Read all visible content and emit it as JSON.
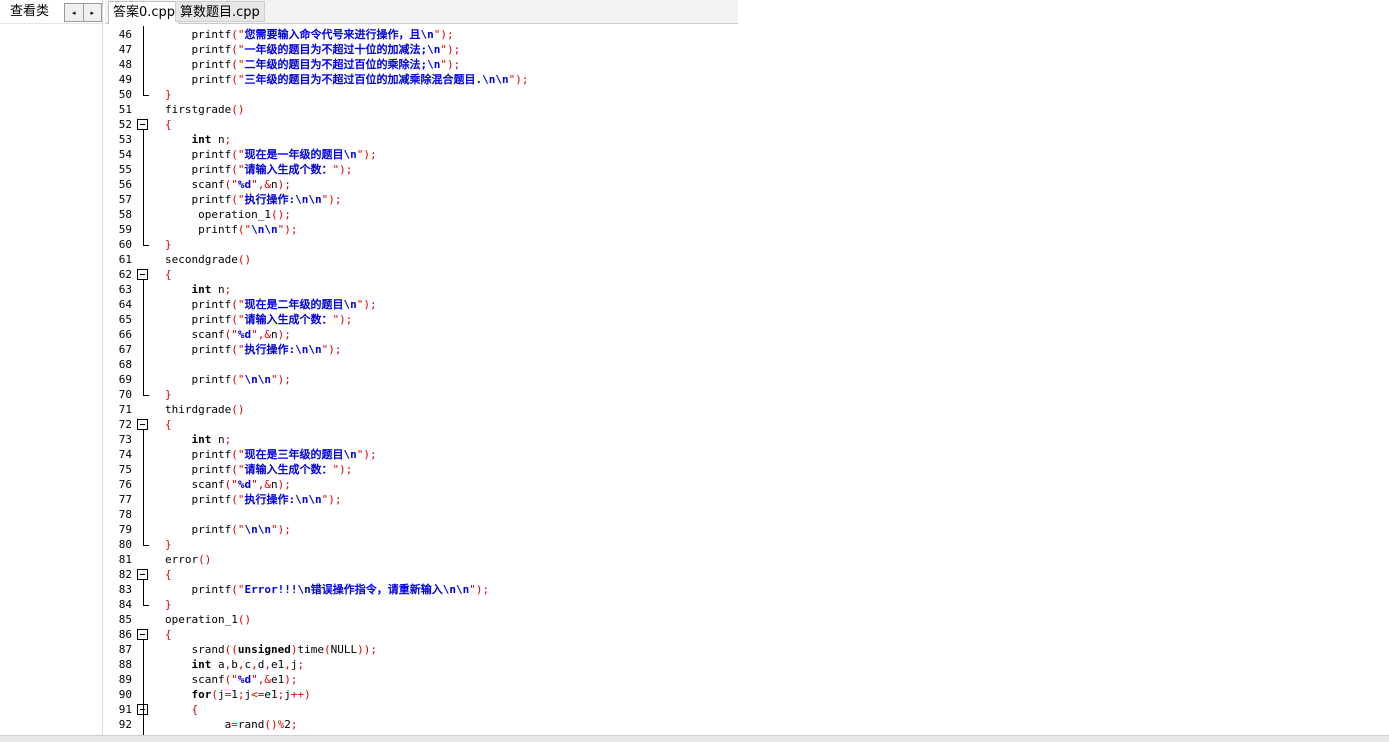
{
  "left_panel": {
    "tab_label": "查看类",
    "prev_arrow": "◂",
    "next_arrow": "▸"
  },
  "tabs": [
    {
      "label": "答案0.cpp",
      "active": true
    },
    {
      "label": "算数题目.cpp",
      "active": false
    }
  ],
  "editor": {
    "lines": [
      {
        "num": "46",
        "code": "    printf(\"您需要输入命令代号来进行操作，且\\n\");"
      },
      {
        "num": "47",
        "code": "    printf(\"一年级的题目为不超过十位的加减法;\\n\");"
      },
      {
        "num": "48",
        "code": "    printf(\"二年级的题目为不超过百位的乘除法;\\n\");"
      },
      {
        "num": "49",
        "code": "    printf(\"三年级的题目为不超过百位的加减乘除混合题目.\\n\\n\");"
      },
      {
        "num": "50",
        "code": "}"
      },
      {
        "num": "51",
        "code": "firstgrade()"
      },
      {
        "num": "52",
        "code": "{"
      },
      {
        "num": "53",
        "code": "    int n;"
      },
      {
        "num": "54",
        "code": "    printf(\"现在是一年级的题目\\n\");"
      },
      {
        "num": "55",
        "code": "    printf(\"请输入生成个数：\");"
      },
      {
        "num": "56",
        "code": "    scanf(\"%d\",&n);"
      },
      {
        "num": "57",
        "code": "    printf(\"执行操作:\\n\\n\");"
      },
      {
        "num": "58",
        "code": "     operation_1();"
      },
      {
        "num": "59",
        "code": "     printf(\"\\n\\n\");"
      },
      {
        "num": "60",
        "code": "}"
      },
      {
        "num": "61",
        "code": "secondgrade()"
      },
      {
        "num": "62",
        "code": "{"
      },
      {
        "num": "63",
        "code": "    int n;"
      },
      {
        "num": "64",
        "code": "    printf(\"现在是二年级的题目\\n\");"
      },
      {
        "num": "65",
        "code": "    printf(\"请输入生成个数：\");"
      },
      {
        "num": "66",
        "code": "    scanf(\"%d\",&n);"
      },
      {
        "num": "67",
        "code": "    printf(\"执行操作:\\n\\n\");"
      },
      {
        "num": "68",
        "code": ""
      },
      {
        "num": "69",
        "code": "    printf(\"\\n\\n\");"
      },
      {
        "num": "70",
        "code": "}"
      },
      {
        "num": "71",
        "code": "thirdgrade()"
      },
      {
        "num": "72",
        "code": "{"
      },
      {
        "num": "73",
        "code": "    int n;"
      },
      {
        "num": "74",
        "code": "    printf(\"现在是三年级的题目\\n\");"
      },
      {
        "num": "75",
        "code": "    printf(\"请输入生成个数：\");"
      },
      {
        "num": "76",
        "code": "    scanf(\"%d\",&n);"
      },
      {
        "num": "77",
        "code": "    printf(\"执行操作:\\n\\n\");"
      },
      {
        "num": "78",
        "code": ""
      },
      {
        "num": "79",
        "code": "    printf(\"\\n\\n\");"
      },
      {
        "num": "80",
        "code": "}"
      },
      {
        "num": "81",
        "code": "error()"
      },
      {
        "num": "82",
        "code": "{"
      },
      {
        "num": "83",
        "code": "    printf(\"Error!!!\\n错误操作指令，请重新输入\\n\\n\");"
      },
      {
        "num": "84",
        "code": "}"
      },
      {
        "num": "85",
        "code": "operation_1()"
      },
      {
        "num": "86",
        "code": "{"
      },
      {
        "num": "87",
        "code": "    srand((unsigned)time(NULL));"
      },
      {
        "num": "88",
        "code": "    int a,b,c,d,e1,j;"
      },
      {
        "num": "89",
        "code": "    scanf(\"%d\",&e1);"
      },
      {
        "num": "90",
        "code": "    for(j=1;j<=e1;j++)"
      },
      {
        "num": "91",
        "code": "    {"
      },
      {
        "num": "92",
        "code": "         a=rand()%2;"
      }
    ],
    "fold_open_lines": [
      "52",
      "62",
      "72",
      "82",
      "86",
      "91"
    ],
    "fold_end_lines": [
      "50",
      "60",
      "70",
      "80",
      "84"
    ]
  },
  "colors": {
    "punctuation": "#e00000",
    "string": "#0000e0",
    "keyword": "#000000"
  }
}
